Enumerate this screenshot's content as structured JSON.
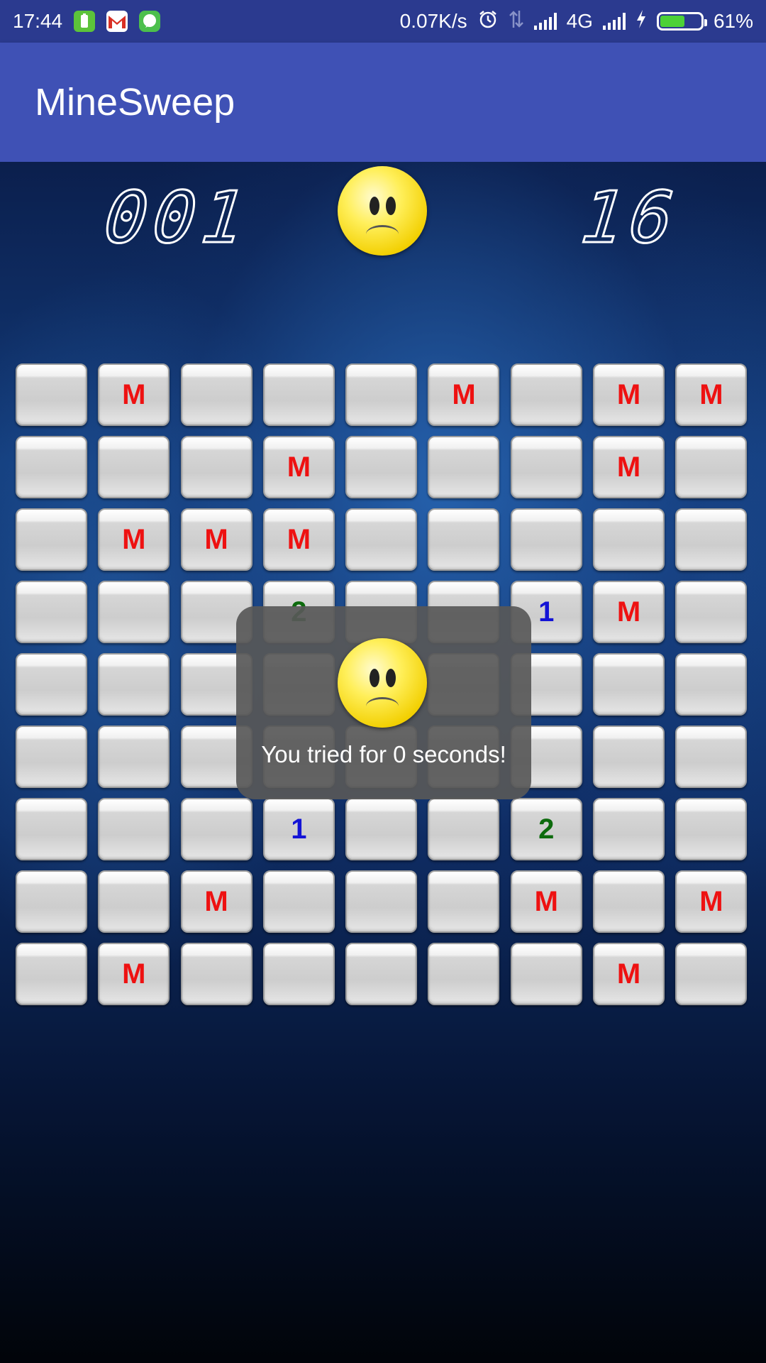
{
  "status_bar": {
    "time": "17:44",
    "network_speed": "0.07K/s",
    "network_type": "4G",
    "battery_percent_label": "61%",
    "battery_level": 0.61,
    "notification_icons": [
      "battery-app-icon",
      "gmail-icon",
      "chat-app-icon"
    ],
    "system_icons": [
      "alarm-icon",
      "data-arrows-icon",
      "signal-icon",
      "signal-icon",
      "charging-icon",
      "battery-icon"
    ]
  },
  "app_bar": {
    "title": "MineSweep"
  },
  "game": {
    "mine_counter": "001",
    "timer": "16",
    "face_state": "sad",
    "grid": [
      [
        "",
        "M",
        "",
        "",
        "",
        "M",
        "",
        "M",
        "M"
      ],
      [
        "",
        "",
        "",
        "M",
        "",
        "",
        "",
        "M",
        ""
      ],
      [
        "",
        "M",
        "M",
        "M",
        "",
        "",
        "",
        "",
        ""
      ],
      [
        "",
        "",
        "",
        "2",
        "",
        "",
        "1",
        "M",
        ""
      ],
      [
        "",
        "",
        "",
        "",
        "",
        "",
        "",
        "",
        ""
      ],
      [
        "",
        "",
        "",
        "",
        "",
        "",
        "",
        "",
        ""
      ],
      [
        "",
        "",
        "",
        "1",
        "",
        "",
        "2",
        "",
        ""
      ],
      [
        "",
        "",
        "M",
        "",
        "",
        "",
        "M",
        "",
        "M"
      ],
      [
        "",
        "M",
        "",
        "",
        "",
        "",
        "",
        "M",
        ""
      ]
    ]
  },
  "toast": {
    "message": "You tried for 0 seconds!",
    "icon": "sad-face-icon"
  },
  "colors": {
    "status_bar": "#2b3a8f",
    "app_bar": "#3f51b5",
    "mine_mark": "#ee1111",
    "number_1": "#1313d6",
    "number_2": "#0d6b0d",
    "toast_bg": "#585858"
  }
}
